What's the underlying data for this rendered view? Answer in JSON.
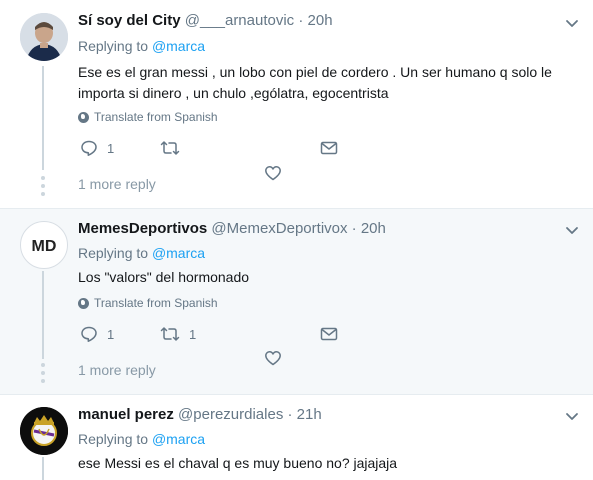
{
  "tweets": [
    {
      "name": "Sí soy del City",
      "handle": "@___arnautovic",
      "separator": "·",
      "time": "20h",
      "replying_prefix": "Replying to",
      "replying_to": "@marca",
      "text": "Ese es el gran messi , un lobo con piel de cordero . Un ser humano q solo le importa si dinero , un chulo ,ególatra, egocentrista",
      "translate": "Translate from Spanish",
      "reply_count": "1",
      "retweet_count": "",
      "more_replies": "1 more reply"
    },
    {
      "name": "MemesDeportivos",
      "handle": "@MemexDeportivox",
      "separator": "·",
      "time": "20h",
      "replying_prefix": "Replying to",
      "replying_to": "@marca",
      "text": "Los \"valors\" del hormonado",
      "translate": "Translate from Spanish",
      "reply_count": "1",
      "retweet_count": "1",
      "more_replies": "1 more reply",
      "avatar_text": "MD"
    },
    {
      "name": "manuel perez",
      "handle": "@perezurdiales",
      "separator": "·",
      "time": "21h",
      "replying_prefix": "Replying to",
      "replying_to": "@marca",
      "text": "ese Messi es el chaval q es muy bueno no? jajajaja"
    }
  ],
  "colors": {
    "accent": "#1da1f2",
    "muted": "#657786",
    "highlight_bg": "#f5f8fa",
    "divider": "#e6ecf0"
  },
  "icons": [
    "chevron-down-icon",
    "reply-icon",
    "retweet-icon",
    "heart-icon",
    "direct-message-icon",
    "globe-icon"
  ]
}
